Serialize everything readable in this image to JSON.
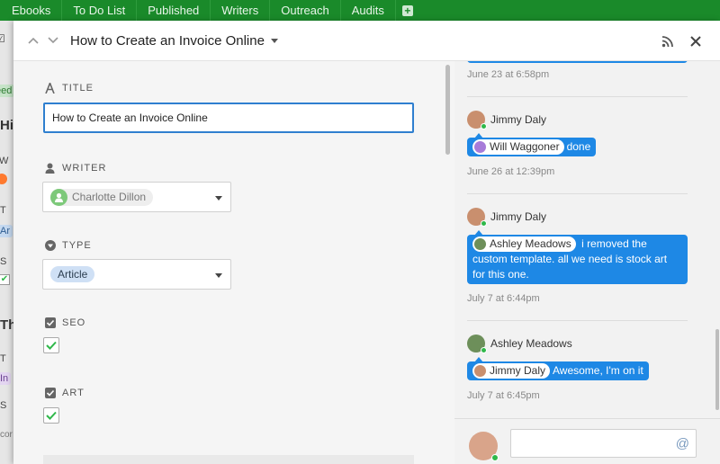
{
  "topbar": {
    "tabs": [
      "Ebooks",
      "To Do List",
      "Published",
      "Writers",
      "Outreach",
      "Audits"
    ],
    "add_icon": "plus-square-icon"
  },
  "board": {
    "fragments": [
      "eed",
      "Hi",
      "W",
      "T",
      "Ar",
      "S",
      "Th",
      "T",
      "In",
      "S",
      "cor"
    ]
  },
  "header": {
    "title": "How to Create an Invoice Online",
    "icons": [
      "chevron-up-icon",
      "chevron-down-icon",
      "caret-down-icon",
      "rss-icon",
      "close-icon"
    ]
  },
  "form": {
    "title_label": "TITLE",
    "title_value": "How to Create an Invoice Online",
    "writer_label": "WRITER",
    "writer_value": "Charlotte Dillon",
    "type_label": "TYPE",
    "type_value": "Article",
    "seo_label": "SEO",
    "seo_checked": true,
    "art_label": "ART",
    "art_checked": true
  },
  "activity": {
    "top_timestamp": "June 23 at 6:58pm",
    "items": [
      {
        "author": "Jimmy Daly",
        "mention": "Will Waggoner",
        "text": "done",
        "timestamp": "June 26 at 12:39pm"
      },
      {
        "author": "Jimmy Daly",
        "mention": "Ashley Meadows",
        "text": "i removed the custom template. all we need is stock art for this one.",
        "timestamp": "July 7 at 6:44pm"
      },
      {
        "author": "Ashley Meadows",
        "mention": "Jimmy Daly",
        "text": "Awesome, I'm on it",
        "timestamp": "July 7 at 6:45pm"
      }
    ],
    "comment_placeholder": "",
    "at_symbol": "@"
  }
}
